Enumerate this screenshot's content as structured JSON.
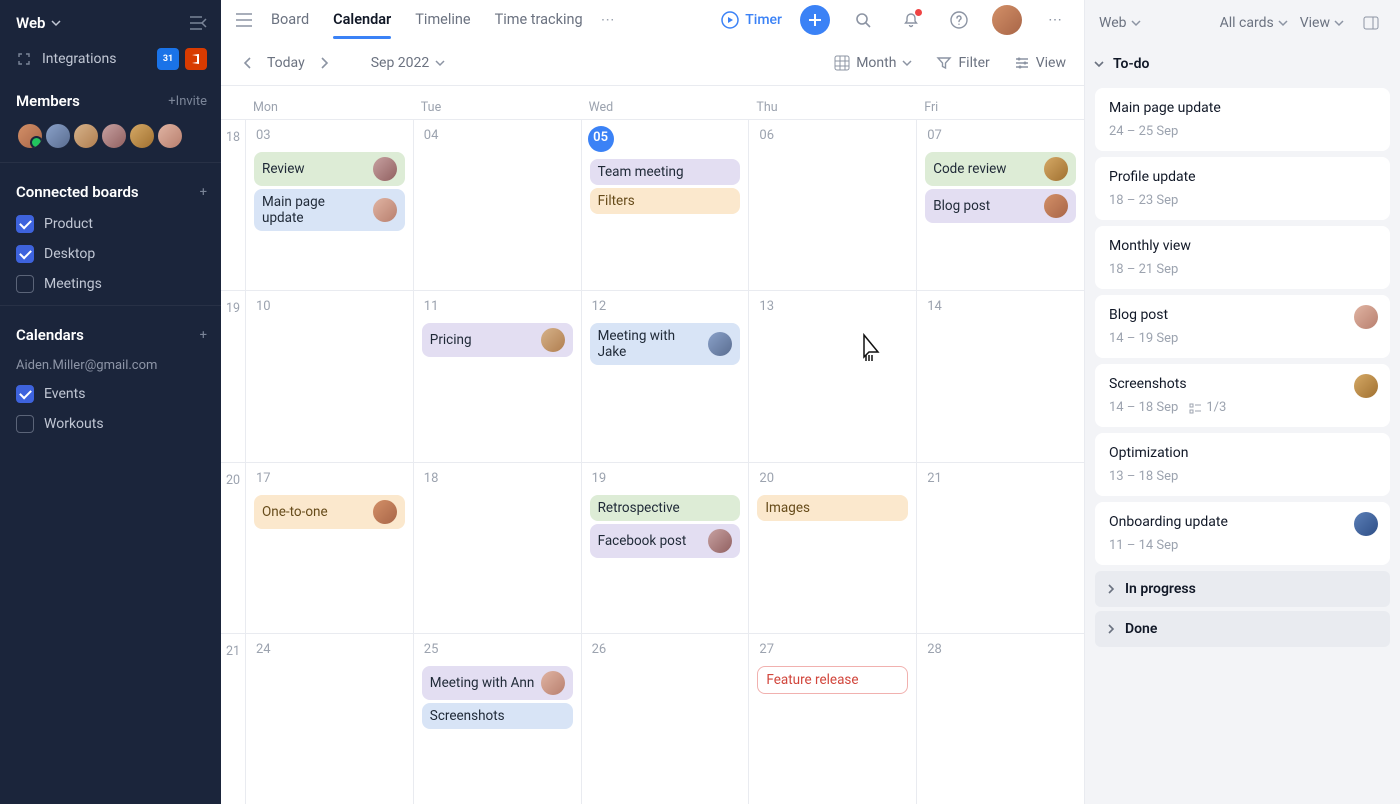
{
  "sidebar": {
    "workspace": "Web",
    "integrations_label": "Integrations",
    "members_label": "Members",
    "invite_label": "+Invite",
    "connected_boards_label": "Connected boards",
    "boards": [
      {
        "label": "Product",
        "checked": true
      },
      {
        "label": "Desktop",
        "checked": true
      },
      {
        "label": "Meetings",
        "checked": false
      }
    ],
    "calendars_label": "Calendars",
    "calendar_email": "Aiden.Miller@gmail.com",
    "calendars": [
      {
        "label": "Events",
        "checked": true
      },
      {
        "label": "Workouts",
        "checked": false
      }
    ]
  },
  "topbar": {
    "tabs": [
      "Board",
      "Calendar",
      "Timeline",
      "Time tracking"
    ],
    "active_tab": "Calendar",
    "timer_label": "Timer"
  },
  "toolbar": {
    "today": "Today",
    "period": "Sep 2022",
    "scale": "Month",
    "filter": "Filter",
    "view": "View"
  },
  "calendar": {
    "dow": [
      "Mon",
      "Tue",
      "Wed",
      "Thu",
      "Fri"
    ],
    "weeks": [
      {
        "num": "18",
        "days": [
          {
            "n": "03",
            "today": false,
            "cards": [
              {
                "t": "Review",
                "c": "c-green",
                "av": "av4"
              },
              {
                "t": "Main page update",
                "c": "c-blue",
                "av": "av6"
              }
            ]
          },
          {
            "n": "04",
            "cards": []
          },
          {
            "n": "05",
            "today": true,
            "cards": [
              {
                "t": "Team meeting",
                "c": "c-purple"
              },
              {
                "t": "Filters",
                "c": "c-orange"
              }
            ]
          },
          {
            "n": "06",
            "cards": []
          },
          {
            "n": "07",
            "cards": [
              {
                "t": "Code review",
                "c": "c-green",
                "av": "av5"
              },
              {
                "t": "Blog post",
                "c": "c-purple",
                "av": "av1"
              }
            ]
          }
        ]
      },
      {
        "num": "19",
        "days": [
          {
            "n": "10",
            "cards": []
          },
          {
            "n": "11",
            "cards": [
              {
                "t": "Pricing",
                "c": "c-purple",
                "av": "av3"
              }
            ]
          },
          {
            "n": "12",
            "cards": [
              {
                "t": "Meeting with Jake",
                "c": "c-blue",
                "av": "av2"
              }
            ]
          },
          {
            "n": "13",
            "cursor": true,
            "cards": []
          },
          {
            "n": "14",
            "cards": []
          }
        ]
      },
      {
        "num": "20",
        "days": [
          {
            "n": "17",
            "cards": [
              {
                "t": "One-to-one",
                "c": "c-orange",
                "av": "av1"
              }
            ]
          },
          {
            "n": "18",
            "cards": []
          },
          {
            "n": "19",
            "cards": [
              {
                "t": "Retrospective",
                "c": "c-green"
              },
              {
                "t": "Facebook post",
                "c": "c-purple",
                "av": "av4"
              }
            ]
          },
          {
            "n": "20",
            "cards": [
              {
                "t": "Images",
                "c": "c-orange"
              }
            ]
          },
          {
            "n": "21",
            "cards": []
          }
        ]
      },
      {
        "num": "21",
        "days": [
          {
            "n": "24",
            "cards": []
          },
          {
            "n": "25",
            "cards": [
              {
                "t": "Meeting with Ann",
                "c": "c-purple",
                "av": "av6"
              },
              {
                "t": "Screenshots",
                "c": "c-blue"
              }
            ]
          },
          {
            "n": "26",
            "cards": []
          },
          {
            "n": "27",
            "cards": [
              {
                "t": "Feature release",
                "c": "c-red"
              }
            ]
          },
          {
            "n": "28",
            "cards": []
          }
        ]
      }
    ]
  },
  "right": {
    "workspace": "Web",
    "all_cards": "All cards",
    "view": "View",
    "sections": [
      {
        "title": "To-do",
        "open": true,
        "cards": [
          {
            "t": "Main page update",
            "d": "24 – 25 Sep"
          },
          {
            "t": "Profile update",
            "d": "18 – 23 Sep"
          },
          {
            "t": "Monthly view",
            "d": "18 – 21 Sep"
          },
          {
            "t": "Blog post",
            "d": "14 – 19 Sep",
            "av": "av6"
          },
          {
            "t": "Screenshots",
            "d": "14 – 18 Sep",
            "sub": "1/3",
            "av": "av5"
          },
          {
            "t": "Optimization",
            "d": "13 – 18 Sep"
          },
          {
            "t": "Onboarding update",
            "d": "11 – 14 Sep",
            "av": "av7"
          }
        ]
      },
      {
        "title": "In progress",
        "open": false
      },
      {
        "title": "Done",
        "open": false
      }
    ]
  }
}
